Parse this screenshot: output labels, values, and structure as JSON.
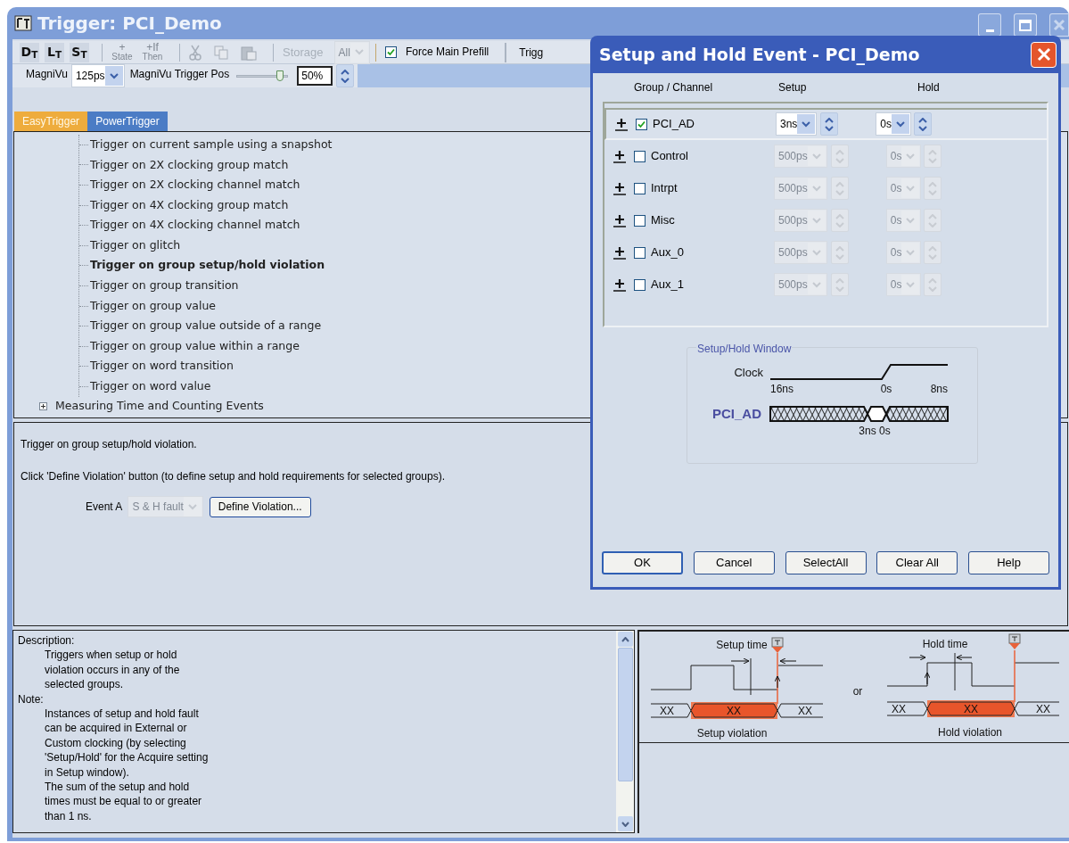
{
  "window": {
    "title": "Trigger: PCI_Demo"
  },
  "toolbar": {
    "trigger_buttons": [
      "D$_{T}$",
      "L$_{T}$",
      "S$_{T}$"
    ],
    "edit_buttons": [
      {
        "top": "+",
        "bottom": "State",
        "disabled": true
      },
      {
        "top": "+If",
        "bottom": "Then",
        "disabled": true
      }
    ],
    "storage": {
      "label": "Storage",
      "value": "All",
      "disabled": true
    },
    "force_main_prefill": {
      "label": "Force Main Prefill",
      "checked": true
    },
    "cut_label": "Trigg"
  },
  "magnivu": {
    "label": "MagniVu",
    "value": "125ps",
    "position_label": "MagniVu Trigger Pos",
    "level": 0.85,
    "percent": "50%"
  },
  "tabs": [
    {
      "label": "EasyTrigger",
      "selected": true
    },
    {
      "label": "PowerTrigger",
      "selected": false
    }
  ],
  "tree": {
    "items": [
      {
        "label": "Trigger on current sample using a snapshot",
        "selected": false
      },
      {
        "label": "Trigger on 2X clocking group match",
        "selected": false
      },
      {
        "label": "Trigger on 2X clocking channel match",
        "selected": false
      },
      {
        "label": "Trigger on 4X clocking group match",
        "selected": false
      },
      {
        "label": "Trigger on 4X clocking channel match",
        "selected": false
      },
      {
        "label": "Trigger on glitch",
        "selected": false
      },
      {
        "label": "Trigger on group setup/hold violation",
        "selected": true
      },
      {
        "label": "Trigger on group transition",
        "selected": false
      },
      {
        "label": "Trigger on group value",
        "selected": false
      },
      {
        "label": "Trigger on group value outside of a range",
        "selected": false
      },
      {
        "label": "Trigger on group value within a range",
        "selected": false
      },
      {
        "label": "Trigger on word transition",
        "selected": false
      },
      {
        "label": "Trigger on word value",
        "selected": false
      }
    ],
    "groups": [
      {
        "label": "Measuring Time and Counting Events",
        "expanded": false
      }
    ]
  },
  "details": {
    "summary": "Trigger on group setup/hold violation.",
    "instruction": "Click 'Define Violation' button (to define setup and hold requirements for selected groups).",
    "event_label": "Event A",
    "event_value": "S & H fault",
    "event_disabled": true,
    "define_button": "Define Violation..."
  },
  "help": {
    "sections": [
      {
        "heading": "Description:",
        "paragraphs": [
          "Triggers when setup or hold violation occurs in any of the selected groups."
        ]
      },
      {
        "heading": "Note:",
        "paragraphs": [
          "Instances of setup and hold fault can be acquired in External or Custom clocking (by selecting 'Setup/Hold' for the Acquire setting in Setup window).",
          "The sum of the setup and hold times must be equal to or greater than 1 ns."
        ]
      }
    ]
  },
  "diagram": {
    "setup": {
      "title": "Setup time",
      "bus": [
        "XX",
        "XX",
        "XX"
      ],
      "caption": "Setup violation"
    },
    "separator": "or",
    "hold": {
      "title": "Hold time",
      "bus": [
        "XX",
        "XX",
        "XX"
      ],
      "caption": "Hold violation"
    }
  },
  "dialog": {
    "title": "Setup and Hold Event - PCI_Demo",
    "columns": [
      "Group / Channel",
      "Setup",
      "Hold"
    ],
    "rows": [
      {
        "name": "PCI_AD",
        "checked": true,
        "selected": true,
        "setup": "3ns",
        "hold": "0s"
      },
      {
        "name": "Control",
        "checked": false,
        "selected": false,
        "setup": "500ps",
        "hold": "0s"
      },
      {
        "name": "Intrpt",
        "checked": false,
        "selected": false,
        "setup": "500ps",
        "hold": "0s"
      },
      {
        "name": "Misc",
        "checked": false,
        "selected": false,
        "setup": "500ps",
        "hold": "0s"
      },
      {
        "name": "Aux_0",
        "checked": false,
        "selected": false,
        "setup": "500ps",
        "hold": "0s"
      },
      {
        "name": "Aux_1",
        "checked": false,
        "selected": false,
        "setup": "500ps",
        "hold": "0s"
      }
    ],
    "window_box": {
      "title": "Setup/Hold Window",
      "clock_label": "Clock",
      "clock_ticks": [
        "16ns",
        "0s",
        "8ns"
      ],
      "bus_label": "PCI_AD",
      "bus_ticks": [
        "3ns 0s"
      ]
    },
    "buttons": [
      {
        "label": "OK",
        "default": true
      },
      {
        "label": "Cancel",
        "default": false
      },
      {
        "label": "SelectAll",
        "default": false
      },
      {
        "label": "Clear All",
        "default": false
      },
      {
        "label": "Help",
        "default": false
      }
    ]
  }
}
